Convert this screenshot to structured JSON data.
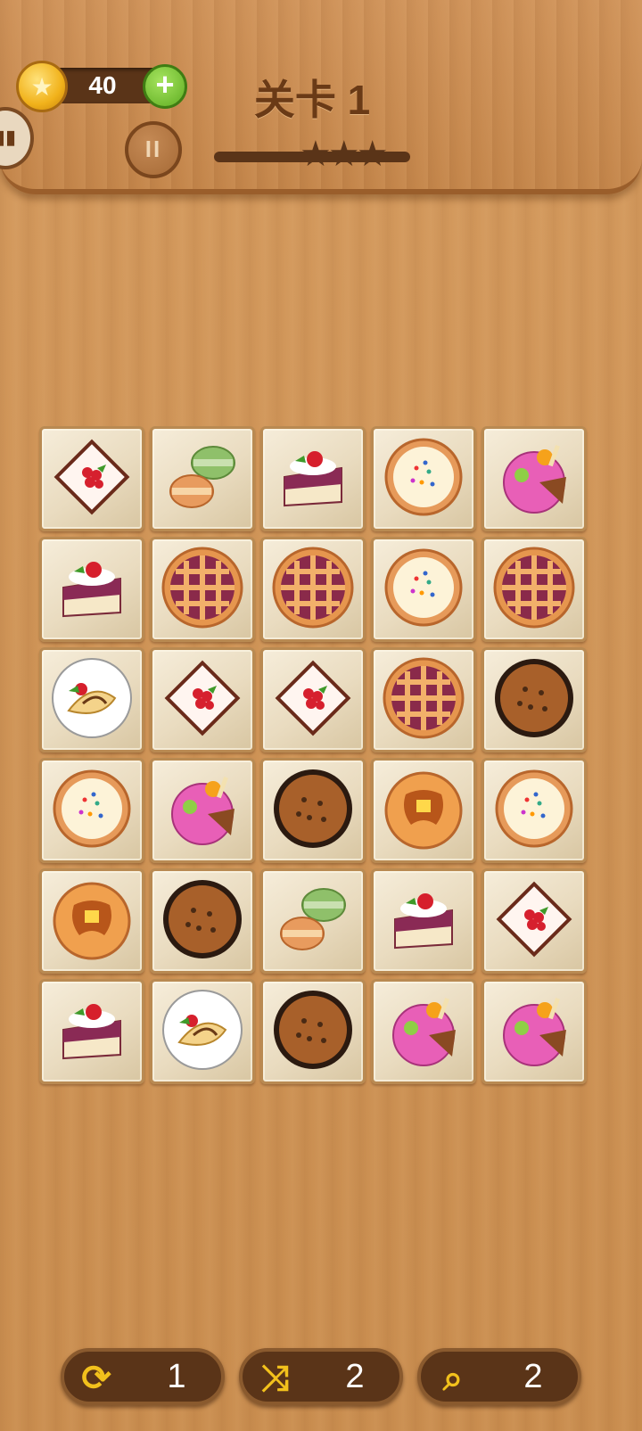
{
  "header": {
    "coins": "40",
    "level_title": "关卡 1",
    "stars_total": 3,
    "progress_fraction": 0.45
  },
  "board": {
    "rows": 6,
    "cols": 5,
    "tiles": [
      [
        "raspberry-plate",
        "macarons",
        "cherry-cake",
        "sprinkle-cookie",
        "ice-cream"
      ],
      [
        "cherry-cake",
        "lattice-pie",
        "lattice-pie",
        "sprinkle-cookie",
        "lattice-pie"
      ],
      [
        "crepe-plate",
        "raspberry-plate",
        "raspberry-plate",
        "lattice-pie",
        "choc-muffin"
      ],
      [
        "sprinkle-cookie",
        "ice-cream",
        "choc-muffin",
        "pancake",
        "sprinkle-cookie"
      ],
      [
        "pancake",
        "choc-muffin",
        "macarons",
        "cherry-cake",
        "raspberry-plate"
      ],
      [
        "cherry-cake",
        "crepe-plate",
        "choc-muffin",
        "ice-cream",
        "ice-cream"
      ]
    ]
  },
  "tools": [
    {
      "icon": "refresh-image-icon",
      "count": "1"
    },
    {
      "icon": "shuffle-icon",
      "count": "2"
    },
    {
      "icon": "search-icon",
      "count": "2"
    }
  ],
  "colors": {
    "wood": "#cf9457",
    "dark_wood": "#5a3418",
    "accent_gold": "#f2c11c",
    "plus_green": "#5fae22"
  }
}
